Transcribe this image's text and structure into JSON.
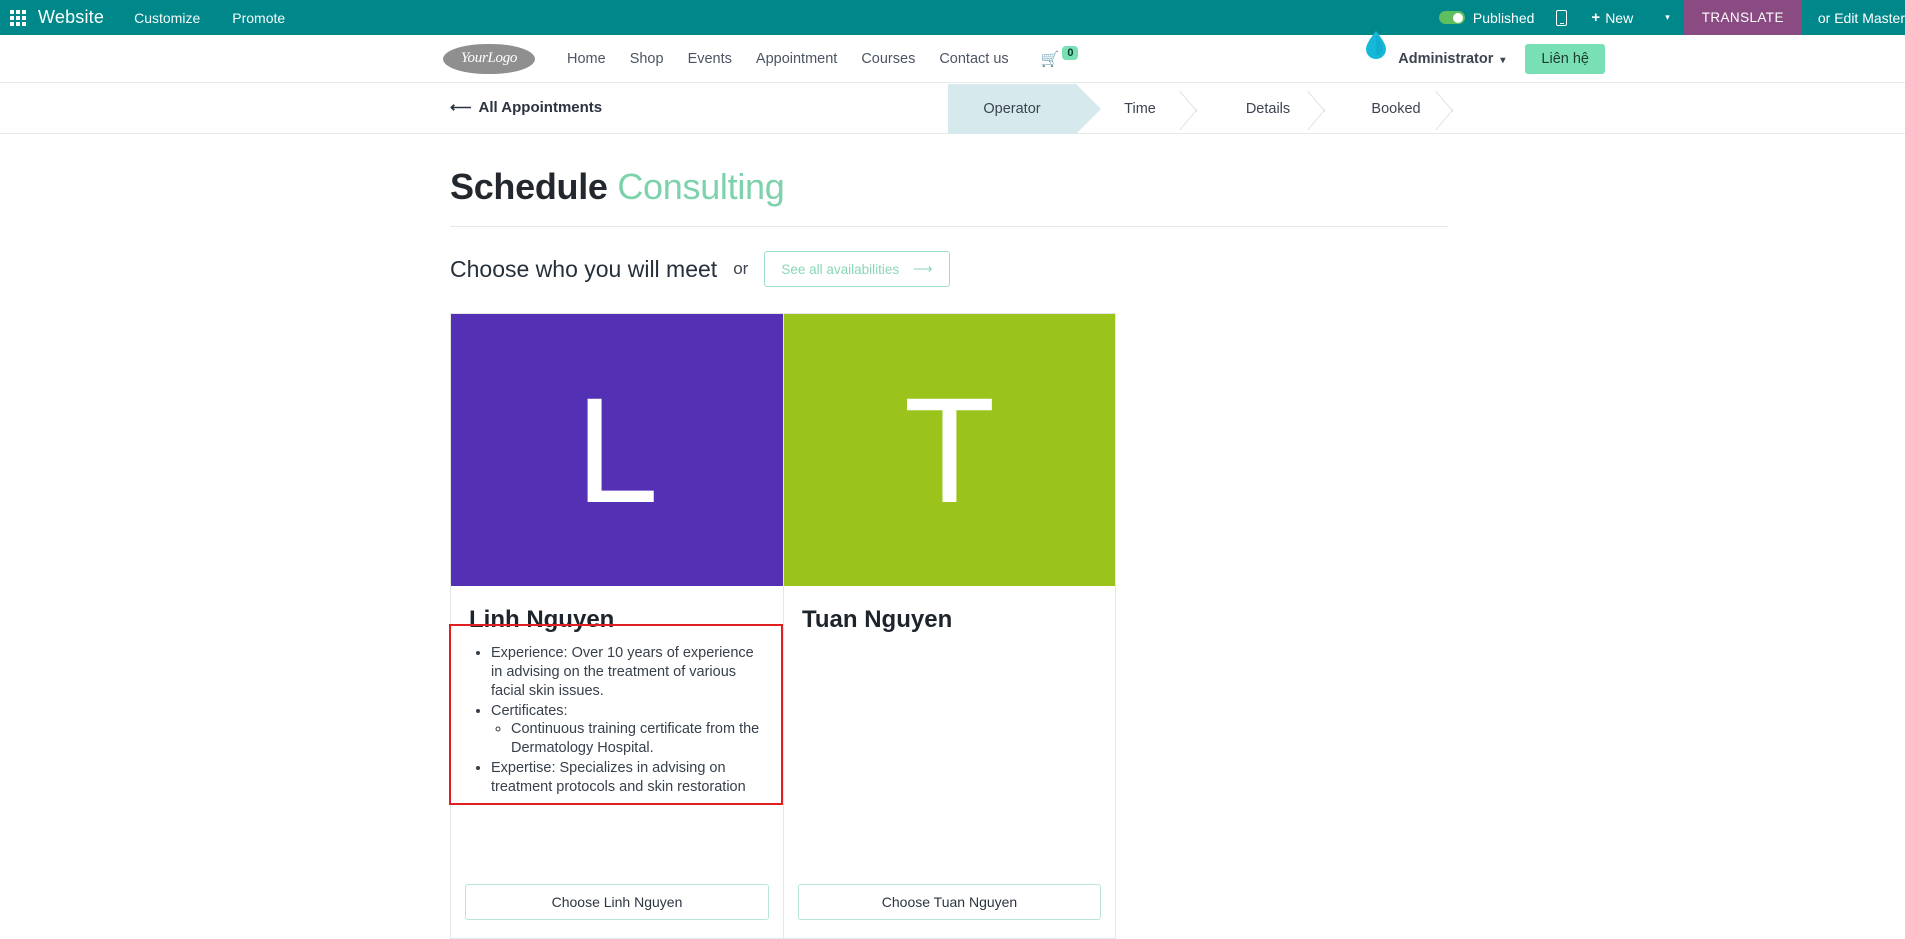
{
  "odoo_bar": {
    "apps_icon": "apps-grid-icon",
    "brand": "Website",
    "menus": [
      "Customize",
      "Promote"
    ],
    "published_label": "Published",
    "mobile_icon": "mobile-preview-icon",
    "new_label": "New",
    "new_plus": "+",
    "caret": "▾",
    "translate_label": "TRANSLATE",
    "edit_master_label": "or Edit Master",
    "bar_color": "#00878a",
    "translate_color": "#8a4b82",
    "toggle_color": "#5fbe5f"
  },
  "site_header": {
    "logo_text": "YourLogo",
    "nav": [
      "Home",
      "Shop",
      "Events",
      "Appointment",
      "Courses",
      "Contact us"
    ],
    "cart_icon": "shopping-cart-icon",
    "cart_count": "0",
    "admin_label": "Administrator",
    "admin_caret": "▾",
    "contact_button": "Liên hệ",
    "accent_color": "#79dfb4"
  },
  "step_bar": {
    "back_arrow": "⟵",
    "back_label": "All Appointments",
    "steps": [
      {
        "label": "Operator",
        "active": true
      },
      {
        "label": "Time",
        "active": false
      },
      {
        "label": "Details",
        "active": false
      },
      {
        "label": "Booked",
        "active": false
      }
    ],
    "active_color": "#d6e9ec"
  },
  "main": {
    "title_primary": "Schedule",
    "title_accent": "Consulting",
    "accent_color": "#7cd2ab",
    "choose_label": "Choose who you will meet",
    "or_label": "or",
    "availabilities_button": "See all availabilities",
    "availabilities_arrow": "⟶"
  },
  "cards": [
    {
      "initial": "L",
      "avatar_color": "#5430b5",
      "name": "Linh Nguyen",
      "bullets": [
        {
          "text": "Experience: Over 10 years of experience in advising on the treatment of various facial skin issues.",
          "sub": []
        },
        {
          "text": "Certificates:",
          "sub": [
            "Continuous training certificate from the Dermatology Hospital."
          ]
        },
        {
          "text": "Expertise: Specializes in advising on treatment protocols and skin restoration",
          "sub": []
        }
      ],
      "choose_button": "Choose Linh Nguyen"
    },
    {
      "initial": "T",
      "avatar_color": "#9ac41b",
      "name": "Tuan Nguyen",
      "bullets": [],
      "choose_button": "Choose Tuan Nguyen"
    }
  ],
  "annotation": {
    "color": "#e02020",
    "name": "highlight-box-operator-description"
  }
}
